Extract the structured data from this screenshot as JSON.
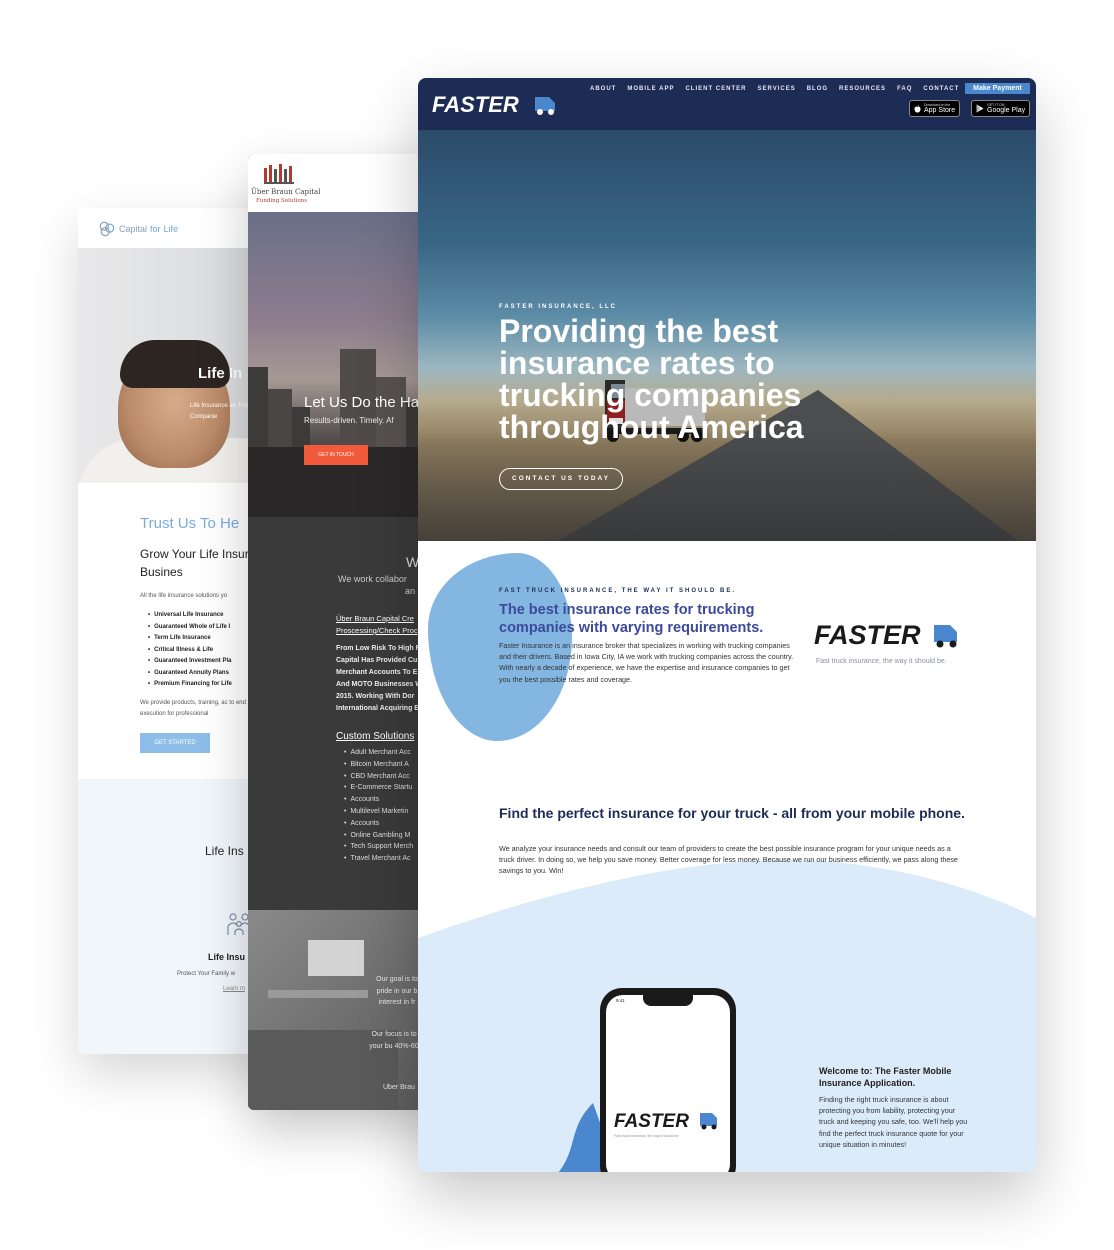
{
  "card_capital": {
    "logo_text": "Capital",
    "logo_for": "for",
    "logo_life": "Life",
    "hero_title": "Life In",
    "hero_sub": "Life Insurance an Trust Companie",
    "heading_blue": "Trust Us To He",
    "heading_dark": "Grow Your Life Insurance Busines",
    "intro": "All the life insurance solutions yo",
    "services": [
      "Universal Life Insurance",
      "Guaranteed Whole of Life I",
      "Term Life Insurance",
      "Critical Illness & Life",
      "Guaranteed Investment Pla",
      "Guaranteed Annuity Plans",
      "Premium Financing for Life"
    ],
    "closing": "We provide products, training, ac to end execution for professional",
    "cta": "GET STARTED",
    "band_title": "Life Ins",
    "band_item_title": "Life Insu",
    "band_item_text": "Protect Your Family w",
    "band_item_link": "Learn m"
  },
  "card_uber": {
    "logo_name": "Über Braun Capital",
    "logo_sub": "Funding Solutions",
    "hero_title": "Let Us Do the Ha",
    "hero_sub": "Results-driven. Timely. Af",
    "hero_cta": "GET IN TOUCH",
    "section_w": "W",
    "section_lead": "We work collabor",
    "section_lead2": "an",
    "link_title_1": "Über Braun Capital Cre",
    "link_title_2": "Proscessing/Check Proc",
    "para_lines": [
      "From Low Risk To High R",
      "Capital Has Provided Cu",
      "Merchant Accounts To E",
      "And MOTO Businesses W",
      "2015. Working With Dor",
      "International Acquiring E"
    ],
    "solutions_title": "Custom Solutions",
    "solutions": [
      "Adult Merchant Acc",
      "Bitcoin Merchant A",
      "CBD Merchant Acc",
      "E-Commerce Startu",
      "Accounts",
      "Multilevel Marketin",
      "Accounts",
      "Online Gambling M",
      "Tech Support Merch",
      "Travel Merchant Ac"
    ],
    "goal": "Our goal is to pride in our b interest in fr",
    "focus": "Our focus is to to your bu 40%-60%.",
    "sign": "Uber Brau"
  },
  "card_faster": {
    "logo": "FASTER",
    "nav": [
      "ABOUT",
      "MOBILE APP",
      "CLIENT CENTER",
      "SERVICES",
      "BLOG",
      "RESOURCES",
      "FAQ",
      "CONTACT"
    ],
    "make_payment": "Make Payment",
    "app_store_small": "Download on the",
    "app_store": "App Store",
    "google_small": "GET IT ON",
    "google": "Google Play",
    "hero_eyebrow": "FASTER INSURANCE, LLC",
    "hero_title": "Providing the best insurance rates to trucking companies throughout America",
    "hero_cta": "CONTACT US TODAY",
    "kicker": "FAST TRUCK INSURANCE, THE WAY IT SHOULD BE.",
    "section_title": "The best insurance rates for trucking companies with varying requirements.",
    "section_text": "Faster Insurance is an insurance broker that specializes in working with trucking companies and their drivers. Based in Iowa City, IA we work with trucking companies across the country. With nearly a decade of experience, we have the expertise and insurance companies to get you the best possible rates and coverage.",
    "tagline": "Fast truck insurance, the way it should be.",
    "mobile_title": "Find the perfect insurance for your truck - all from your mobile phone.",
    "mobile_text": "We analyze your insurance needs and consult our team of providers to create the best possible insurance program for your unique needs as a truck driver. In doing so, we help you save money. Better coverage for less money. Because we run our business efficiently, we pass along these savings to you. Win!",
    "phone_time": "9:41",
    "phone_tagline": "Fast truck insurance, the way it should be.",
    "welcome_title": "Welcome to: The Faster Mobile Insurance Application.",
    "welcome_text": "Finding the right truck insurance is about protecting you from liability, protecting your truck and keeping you safe, too. We'll help you find the perfect truck insurance quote for your unique situation in minutes!"
  },
  "colors": {
    "faster_navy": "#1d2c55",
    "faster_blue": "#4a87cf",
    "faster_heading": "#3c4a9a",
    "capital_blue": "#7aacde",
    "uber_orange": "#f25a3c"
  }
}
